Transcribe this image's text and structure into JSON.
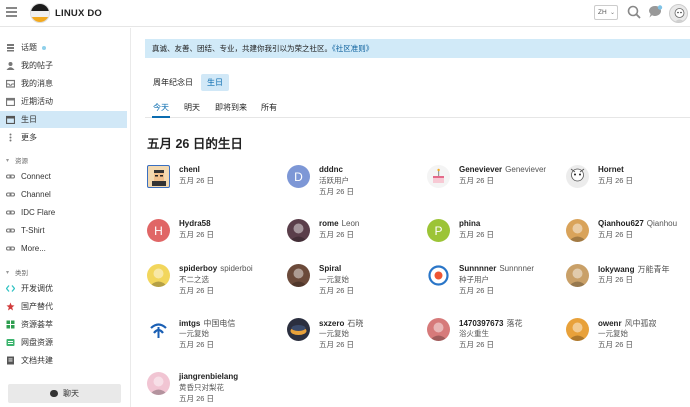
{
  "header": {
    "site_title": "LINUX DO",
    "lang_label": "ZH",
    "icons": [
      "menu-icon",
      "site-logo",
      "search-icon",
      "chat-icon",
      "user-avatar"
    ]
  },
  "sidebar": {
    "top_items": [
      {
        "label": "话题",
        "icon": "topics-icon",
        "badge": true
      },
      {
        "label": "我的帖子",
        "icon": "user-icon"
      },
      {
        "label": "我的消息",
        "icon": "inbox-icon"
      },
      {
        "label": "近期活动",
        "icon": "calendar-icon"
      },
      {
        "label": "生日",
        "icon": "calendar-icon",
        "active": true
      },
      {
        "label": "更多",
        "icon": "more-icon"
      }
    ],
    "resources_title": "资源",
    "resources": [
      {
        "label": "Connect",
        "icon": "link-icon"
      },
      {
        "label": "Channel",
        "icon": "link-icon"
      },
      {
        "label": "IDC Flare",
        "icon": "link-icon"
      },
      {
        "label": "T-Shirt",
        "icon": "link-icon"
      },
      {
        "label": "More...",
        "icon": "link-icon"
      }
    ],
    "categories_title": "类别",
    "categories": [
      {
        "label": "开发调优",
        "color": "#32c3c3",
        "icon": "code-icon"
      },
      {
        "label": "国产替代",
        "color": "#d13b3b",
        "icon": "flag-icon"
      },
      {
        "label": "资源荟萃",
        "color": "#2e9e4f",
        "icon": "grid-icon"
      },
      {
        "label": "网盘资源",
        "color": "#3cb46e",
        "icon": "cloud-icon"
      },
      {
        "label": "文档共建",
        "color": "#555555",
        "icon": "doc-icon"
      }
    ],
    "chat_button": "聊天"
  },
  "banner": {
    "text": "真诚、友善、团结、专业，共建你我引以为荣之社区。",
    "link": "《社区准则》"
  },
  "tabs_primary": [
    {
      "label": "周年纪念日",
      "selected": false
    },
    {
      "label": "生日",
      "selected": true
    }
  ],
  "tabs_secondary": [
    {
      "label": "今天",
      "selected": true
    },
    {
      "label": "明天",
      "selected": false
    },
    {
      "label": "即将到来",
      "selected": false
    },
    {
      "label": "所有",
      "selected": false
    }
  ],
  "page_title": "五月 26 日的生日",
  "users": [
    {
      "username": "chenl",
      "name": "",
      "title": "",
      "date": "五月 26 日",
      "avatar": "pixel",
      "color": "#f3d9b0"
    },
    {
      "username": "dddnc",
      "name": "",
      "title": "活跃用户",
      "date": "五月 26 日",
      "avatar": "D",
      "color": "#7d97d6"
    },
    {
      "username": "Geneviever",
      "name": "Geneviever",
      "title": "",
      "date": "五月 26 日",
      "avatar": "cake",
      "color": "#f4f4f4"
    },
    {
      "username": "Hornet",
      "name": "",
      "title": "",
      "date": "五月 26 日",
      "avatar": "sketch",
      "color": "#ececec"
    },
    {
      "username": "Hydra58",
      "name": "",
      "title": "",
      "date": "五月 26 日",
      "avatar": "H",
      "color": "#e06666"
    },
    {
      "username": "rome",
      "name": "Leon",
      "title": "",
      "date": "五月 26 日",
      "avatar": "photo",
      "color": "#5a3e4a"
    },
    {
      "username": "phina",
      "name": "",
      "title": "",
      "date": "五月 26 日",
      "avatar": "P",
      "color": "#9cc436"
    },
    {
      "username": "Qianhou627",
      "name": "Qianhou",
      "title": "",
      "date": "五月 26 日",
      "avatar": "dog",
      "color": "#d9a35a"
    },
    {
      "username": "spiderboy",
      "name": "spiderboi",
      "title": "不二之选",
      "date": "五月 26 日",
      "avatar": "cartoon",
      "color": "#f2d65c"
    },
    {
      "username": "Spiral",
      "name": "",
      "title": "一元复始",
      "date": "五月 26 日",
      "avatar": "anime",
      "color": "#6b4a3a"
    },
    {
      "username": "Sunnnner",
      "name": "Sunnnner",
      "title": "种子用户",
      "date": "五月 26 日",
      "avatar": "ring",
      "color": "#2a76c8"
    },
    {
      "username": "lokywang",
      "name": "万能青年",
      "title": "",
      "date": "五月 26 日",
      "avatar": "lion",
      "color": "#c9a068"
    },
    {
      "username": "imtgs",
      "name": "中国电信",
      "title": "一元复始",
      "date": "五月 26 日",
      "avatar": "telecom",
      "color": "#1a5fb4"
    },
    {
      "username": "sxzero",
      "name": "石晓",
      "title": "一元复始",
      "date": "五月 26 日",
      "avatar": "dark",
      "color": "#2b2f3f"
    },
    {
      "username": "1470397673",
      "name": "落花",
      "title": "浴火重生",
      "date": "五月 26 日",
      "avatar": "girl",
      "color": "#d67a7a"
    },
    {
      "username": "owenr",
      "name": "风中孤寂",
      "title": "一元复始",
      "date": "五月 26 日",
      "avatar": "orange",
      "color": "#e8a13a"
    },
    {
      "username": "jiangrenbielang",
      "name": "",
      "title": "黄昏只对梨花",
      "date": "五月 26 日",
      "avatar": "pink",
      "color": "#f1c5d3"
    }
  ]
}
